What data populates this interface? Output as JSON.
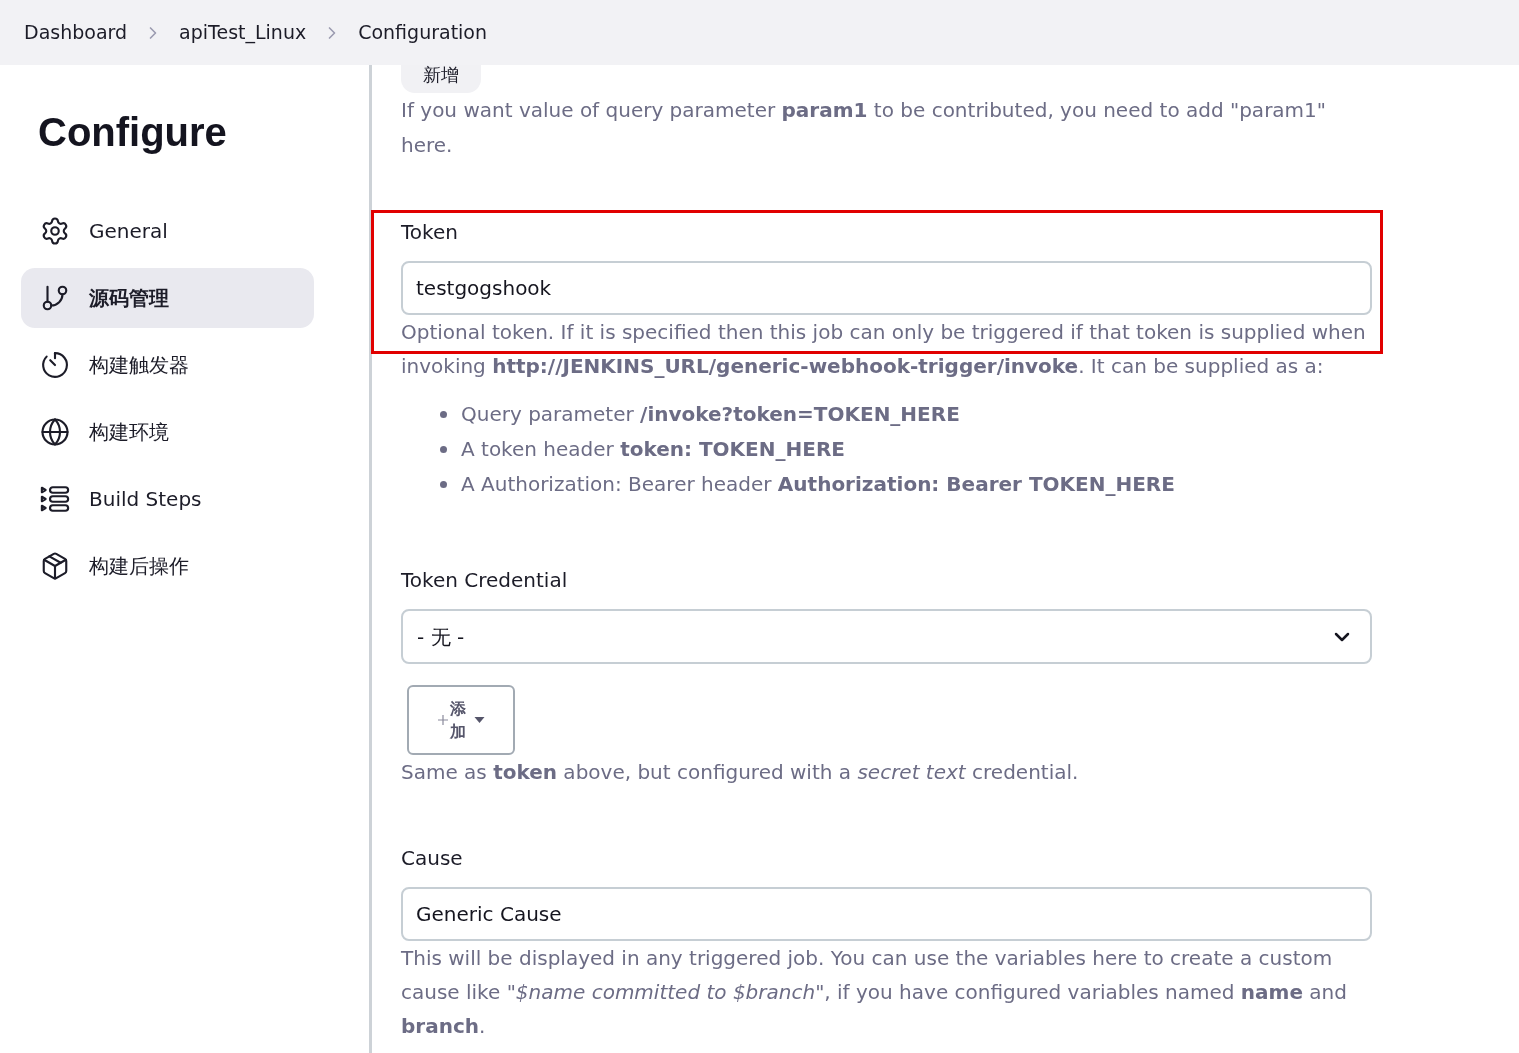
{
  "breadcrumb": [
    {
      "label": "Dashboard"
    },
    {
      "label": "apiTest_Linux"
    },
    {
      "label": "Configuration"
    }
  ],
  "sidebar": {
    "title": "Configure",
    "items": [
      {
        "label": "General",
        "selected": false
      },
      {
        "label": "源码管理",
        "selected": true
      },
      {
        "label": "构建触发器",
        "selected": false
      },
      {
        "label": "构建环境",
        "selected": false
      },
      {
        "label": "Build Steps",
        "selected": false
      },
      {
        "label": "构建后操作",
        "selected": false
      }
    ]
  },
  "content": {
    "top_button": "新增",
    "intro": "If you want value of query parameter **param1** to be contributed, you need to add \"param1\" here.",
    "fields": [
      {
        "kind": "text",
        "label": "Token",
        "value": "testgogshook",
        "highlighted": true,
        "help": "Optional token. If it is specified then this job can only be triggered if that token is supplied when invoking **http://JENKINS_URL/generic-webhook-trigger/invoke**. It can be supplied as a:",
        "help_list": [
          "Query parameter **/invoke?token=TOKEN_HERE**",
          "A token header **token: TOKEN_HERE**",
          "A Authorization: Bearer header **Authorization: Bearer TOKEN_HERE**"
        ]
      },
      {
        "kind": "select",
        "label": "Token Credential",
        "value": "- 无 -",
        "add_button": "添加",
        "help": "Same as **token** above, but configured with a *secret text* credential."
      },
      {
        "kind": "text",
        "label": "Cause",
        "value": "Generic Cause",
        "highlighted": false,
        "help": "This will be displayed in any triggered job. You can use the variables here to create a custom cause like *\"$name committed to $branch\"*, if you have configured variables named **name** and **branch**."
      }
    ]
  }
}
